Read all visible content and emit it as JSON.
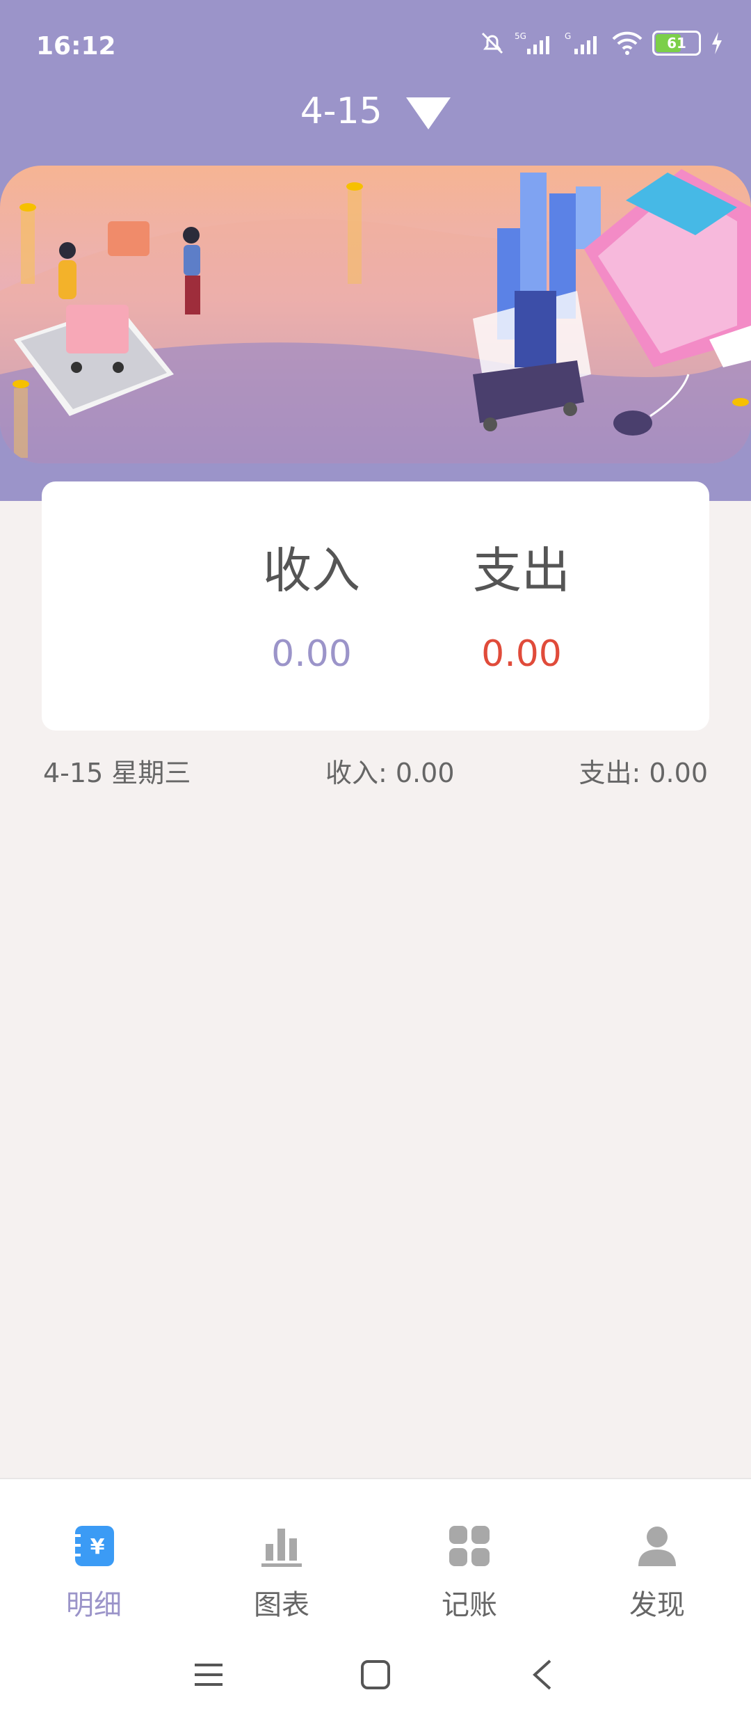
{
  "status_bar": {
    "time": "16:12",
    "battery_level": "61"
  },
  "header": {
    "date_label": "4-15"
  },
  "summary_card": {
    "income_label": "收入",
    "income_value": "0.00",
    "expense_label": "支出",
    "expense_value": "0.00"
  },
  "day_row": {
    "date": "4-15  星期三",
    "income": "收入: 0.00",
    "expense": "支出: 0.00"
  },
  "bottom_nav": {
    "items": [
      {
        "label": "明细",
        "icon": "ledger-icon"
      },
      {
        "label": "图表",
        "icon": "bar-chart-icon"
      },
      {
        "label": "记账",
        "icon": "grid-icon"
      },
      {
        "label": "发现",
        "icon": "person-icon"
      }
    ],
    "active_index": 0
  },
  "colors": {
    "accent": "#9b94c9",
    "expense": "#e04b3a",
    "active_icon": "#3b9bf5"
  }
}
